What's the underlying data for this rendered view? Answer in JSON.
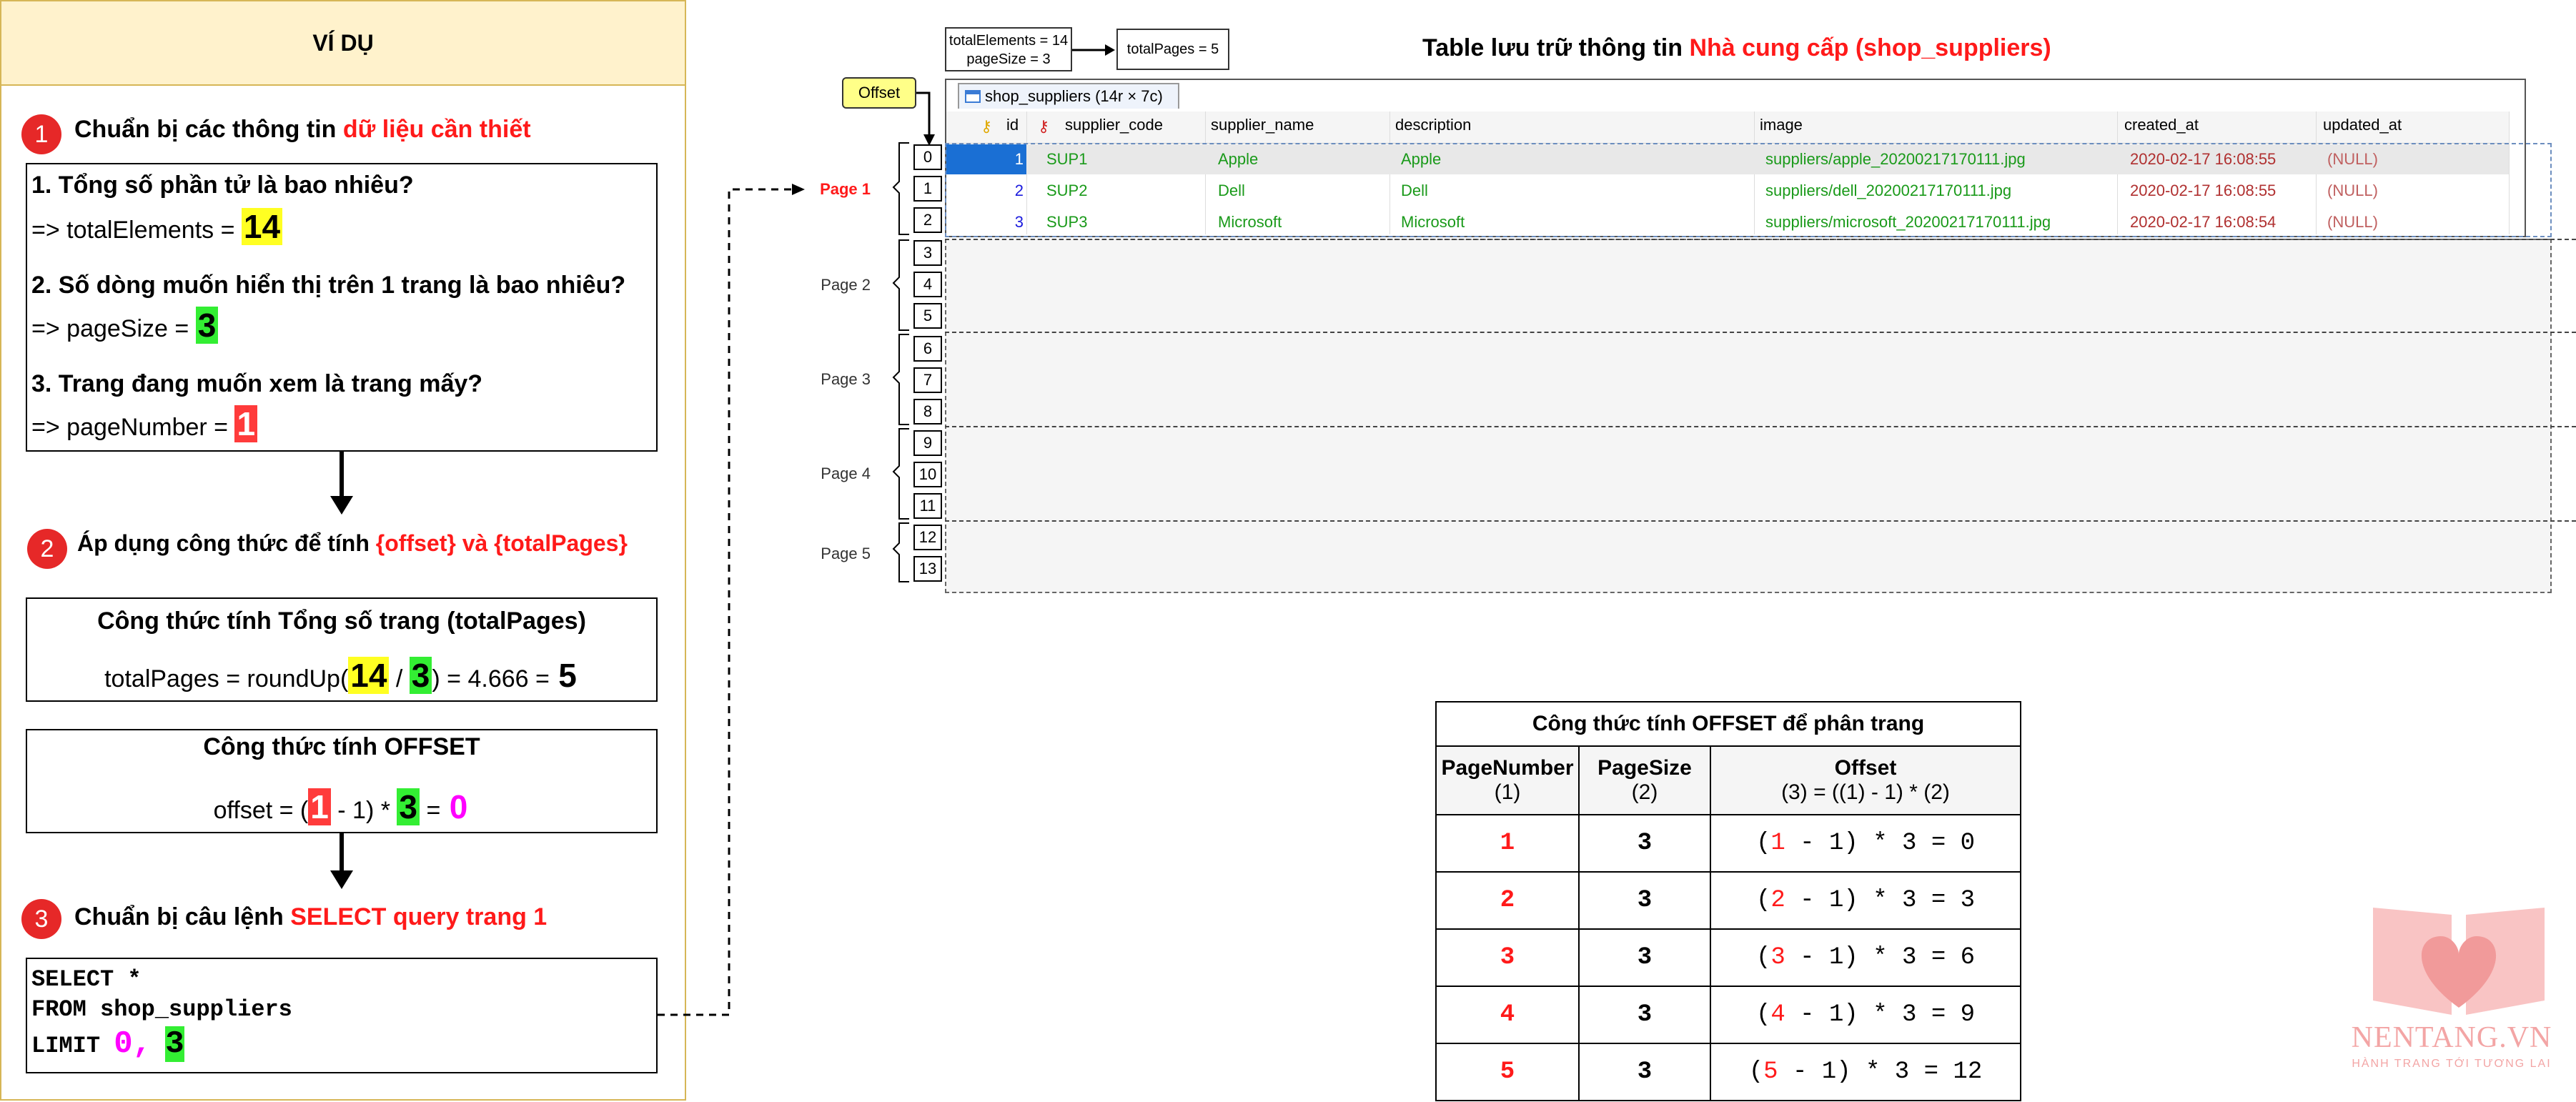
{
  "left": {
    "header": "VÍ DỤ",
    "steps": [
      {
        "num": "1",
        "title_prefix": "Chuẩn bị các thông tin ",
        "title_highlight": "dữ liệu cần thiết"
      },
      {
        "num": "2",
        "title_prefix": "Áp dụng công thức để tính ",
        "title_highlight": "{offset} và {totalPages}"
      },
      {
        "num": "3",
        "title_prefix": "Chuẩn bị câu lệnh ",
        "title_highlight": "SELECT query trang 1"
      }
    ],
    "questions": [
      {
        "q": "1. Tổng số phần tử là bao nhiêu?",
        "a_prefix": "=> totalElements = ",
        "value": "14"
      },
      {
        "q": "2. Số dòng muốn hiển thị trên 1 trang là bao nhiêu?",
        "a_prefix": "=> pageSize = ",
        "value": "3"
      },
      {
        "q": "3. Trang đang muốn xem là trang mấy?",
        "a_prefix": "=> pageNumber = ",
        "value": "1"
      }
    ],
    "formula_total": {
      "title": "Công thức tính Tổng số trang (totalPages)",
      "expr_prefix": "totalPages = roundUp(",
      "a": "14",
      "sep": " / ",
      "b": "3",
      "expr_suffix": ") = 4.666 = ",
      "result": "5"
    },
    "formula_offset": {
      "title": "Công thức tính OFFSET",
      "expr_prefix": "offset = (",
      "a": "1",
      "mid": " - 1) * ",
      "b": "3",
      "eq": " = ",
      "result": "0"
    },
    "sql": {
      "line1": "SELECT *",
      "line2": "FROM shop_suppliers",
      "line3_prefix": "LIMIT ",
      "offset": "0,",
      "limit": "3"
    }
  },
  "top": {
    "info_box": {
      "line1": "totalElements = 14",
      "line2": "pageSize = 3"
    },
    "total_pages_box": "totalPages = 5",
    "title_prefix": "Table lưu trữ thông tin ",
    "title_highlight": "Nhà cung cấp (shop_suppliers)",
    "offset_label": "Offset",
    "tab_label": "shop_suppliers (14r × 7c)"
  },
  "db_table": {
    "columns": [
      "id",
      "supplier_code",
      "supplier_name",
      "description",
      "image",
      "created_at",
      "updated_at"
    ],
    "rows": [
      {
        "id": "1",
        "code": "SUP1",
        "name": "Apple",
        "desc": "Apple",
        "image": "suppliers/apple_20200217170111.jpg",
        "created": "2020-02-17 16:08:55",
        "updated": "(NULL)"
      },
      {
        "id": "2",
        "code": "SUP2",
        "name": "Dell",
        "desc": "Dell",
        "image": "suppliers/dell_20200217170111.jpg",
        "created": "2020-02-17 16:08:55",
        "updated": "(NULL)"
      },
      {
        "id": "3",
        "code": "SUP3",
        "name": "Microsoft",
        "desc": "Microsoft",
        "image": "suppliers/microsoft_20200217170111.jpg",
        "created": "2020-02-17 16:08:54",
        "updated": "(NULL)"
      }
    ],
    "row_numbers": [
      "0",
      "1",
      "2",
      "3",
      "4",
      "5",
      "6",
      "7",
      "8",
      "9",
      "10",
      "11",
      "12",
      "13"
    ],
    "pages": [
      "Page 1",
      "Page 2",
      "Page 3",
      "Page 4",
      "Page 5"
    ]
  },
  "offset_table": {
    "title": "Công thức tính OFFSET để phân trang",
    "headers": [
      {
        "l1": "PageNumber",
        "l2": "(1)"
      },
      {
        "l1": "PageSize",
        "l2": "(2)"
      },
      {
        "l1": "Offset",
        "l2": "(3) = ((1) - 1) * (2)"
      }
    ],
    "rows": [
      {
        "page": "1",
        "size": "3",
        "pre": "(",
        "n": "1",
        "post": " - 1) * 3 = 0"
      },
      {
        "page": "2",
        "size": "3",
        "pre": "(",
        "n": "2",
        "post": " - 1) * 3 = 3"
      },
      {
        "page": "3",
        "size": "3",
        "pre": "(",
        "n": "3",
        "post": " - 1) * 3 = 6"
      },
      {
        "page": "4",
        "size": "3",
        "pre": "(",
        "n": "4",
        "post": " - 1) * 3 = 9"
      },
      {
        "page": "5",
        "size": "3",
        "pre": "(",
        "n": "5",
        "post": " - 1) * 3 = 12"
      }
    ]
  },
  "logo": {
    "name": "NENTANG.VN",
    "tagline": "HÀNH TRANG TỚI TƯƠNG LAI"
  }
}
